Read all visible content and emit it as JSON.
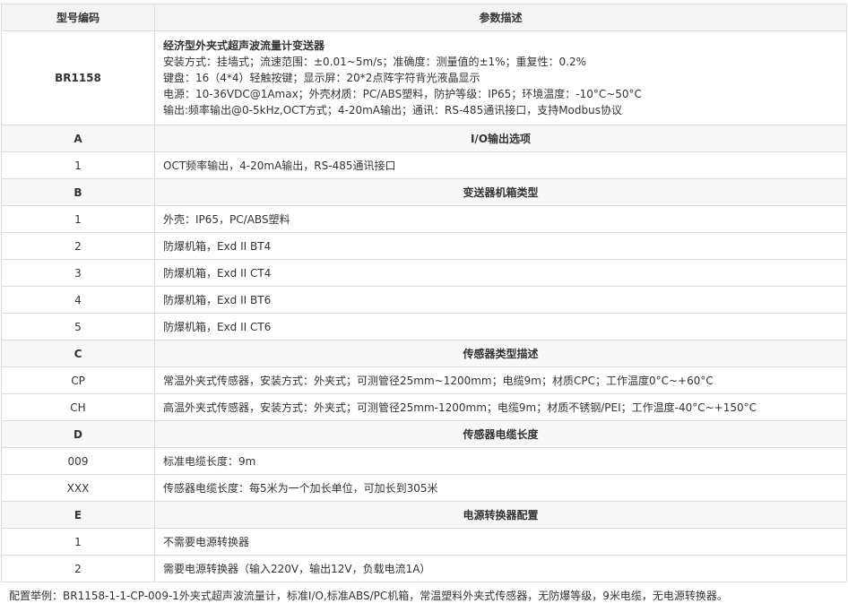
{
  "header": {
    "col1": "型号编码",
    "col2": "参数描述"
  },
  "intro": {
    "code": "BR1158",
    "title": "经济型外夹式超声波流量计变送器",
    "lines": [
      "安装方式：挂墙式；流速范围：±0.01~5m/s；准确度：测量值的±1%；重复性：0.2%",
      "键盘：16（4*4）轻触按键；显示屏：20*2点阵字符背光液晶显示",
      "电源：10-36VDC@1Amax；外壳材质：PC/ABS塑料，防护等级：IP65；环境温度：-10°C~50°C",
      "输出:频率输出@0-5kHz,OCT方式；4-20mA输出；通讯：RS-485通讯接口，支持Modbus协议"
    ]
  },
  "sections": [
    {
      "code": "A",
      "title": "I/O输出选项",
      "rows": [
        {
          "code": "1",
          "desc": "OCT频率输出，4-20mA输出，RS-485通讯接口"
        }
      ]
    },
    {
      "code": "B",
      "title": "变送器机箱类型",
      "rows": [
        {
          "code": "1",
          "desc": "外壳：IP65，PC/ABS塑料"
        },
        {
          "code": "2",
          "desc": "防爆机箱，Exd II BT4"
        },
        {
          "code": "3",
          "desc": "防爆机箱，Exd II CT4"
        },
        {
          "code": "4",
          "desc": "防爆机箱，Exd II BT6"
        },
        {
          "code": "5",
          "desc": "防爆机箱，Exd II CT6"
        }
      ]
    },
    {
      "code": "C",
      "title": "传感器类型描述",
      "rows": [
        {
          "code": "CP",
          "desc": "常温外夹式传感器，安装方式：外夹式；可测管径25mm~1200mm；电缆9m；材质CPC；工作温度0°C~+60°C"
        },
        {
          "code": "CH",
          "desc": "高温外夹式传感器，安装方式：外夹式；可测管径25mm-1200mm；电缆9m；材质不锈钢/PEI；工作温度-40°C~+150°C"
        }
      ]
    },
    {
      "code": "D",
      "title": "传感器电缆长度",
      "rows": [
        {
          "code": "009",
          "desc": "标准电缆长度：9m"
        },
        {
          "code": "XXX",
          "desc": "传感器电缆长度：每5米为一个加长单位，可加长到305米"
        }
      ]
    },
    {
      "code": "E",
      "title": "电源转换器配置",
      "rows": [
        {
          "code": "1",
          "desc": "不需要电源转换器"
        },
        {
          "code": "2",
          "desc": "需要电源转换器（输入220V，输出12V，负载电流1A）"
        }
      ]
    }
  ],
  "example": "配置举例：BR1158-1-1-CP-009-1外夹式超声波流量计，标准I/O,标准ABS/PC机箱，常温塑料外夹式传感器，无防爆等级，9米电缆，无电源转换器。"
}
